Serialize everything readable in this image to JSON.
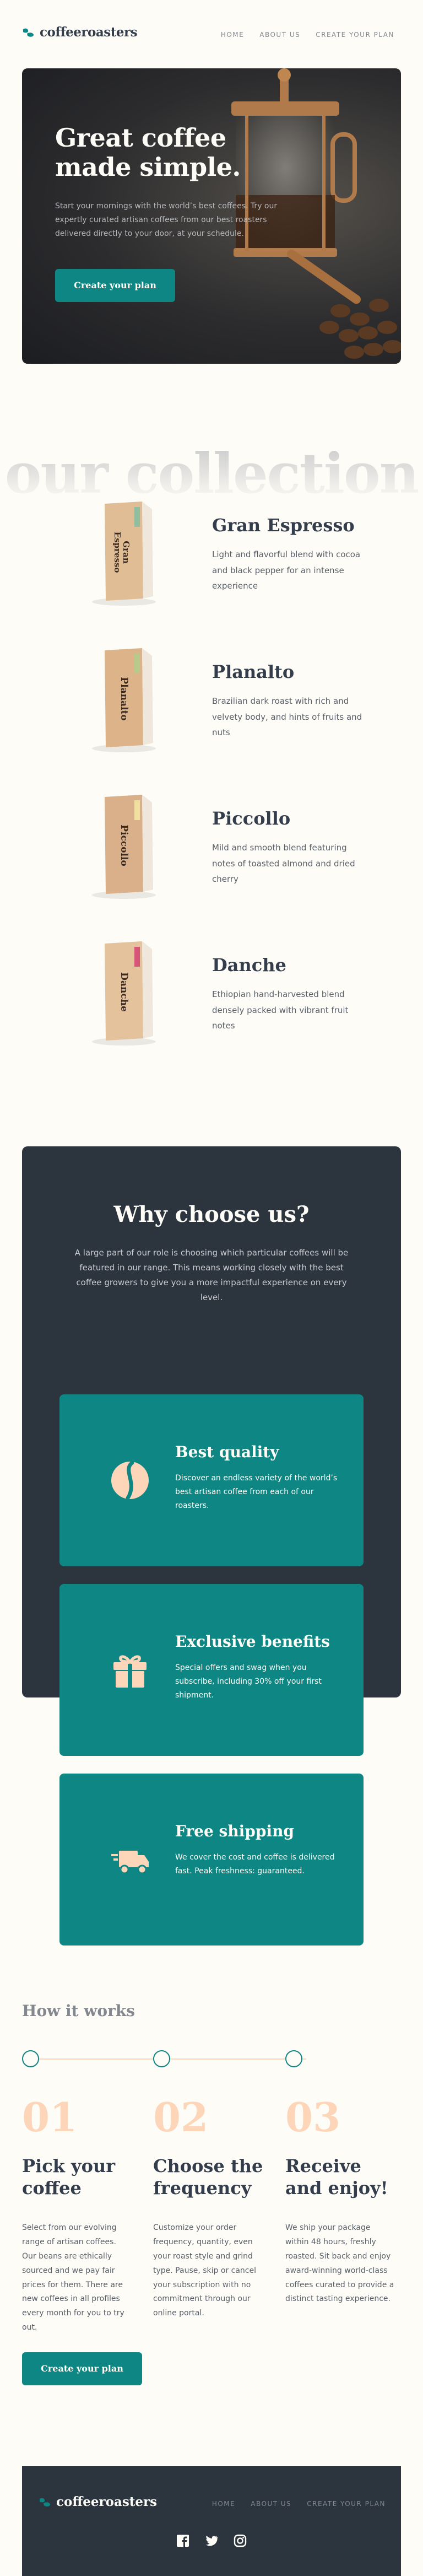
{
  "brand": {
    "name": "coffeeroasters",
    "accent": "#0E8784",
    "dark": "#2C343E",
    "cream": "#FEFCF7",
    "peach": "#FDD6BA"
  },
  "nav": {
    "items": [
      "HOME",
      "ABOUT US",
      "CREATE YOUR PLAN"
    ]
  },
  "hero": {
    "title": "Great coffee made simple.",
    "text": "Start your mornings with the world’s best coffees. Try our expertly curated artisan coffees from our best roasters delivered directly to your door, at your schedule.",
    "cta": "Create your plan"
  },
  "collection": {
    "title": "our collection",
    "items": [
      {
        "name": "Gran Espresso",
        "desc": "Light and flavorful blend with cocoa and black pepper for an intense experience",
        "accent": "#8FBE9E",
        "bag_label": "Gran Espresso"
      },
      {
        "name": "Planalto",
        "desc": "Brazilian dark roast with rich and velvety body, and hints of fruits and nuts",
        "accent": "#B7C98B",
        "bag_label": "Planalto"
      },
      {
        "name": "Piccollo",
        "desc": "Mild and smooth blend featuring notes of toasted almond and dried cherry",
        "accent": "#F0E0A0",
        "bag_label": "Piccollo"
      },
      {
        "name": "Danche",
        "desc": "Ethiopian hand-harvested blend densely packed with vibrant fruit notes",
        "accent": "#D8557A",
        "bag_label": "Danche"
      }
    ]
  },
  "why": {
    "title": "Why choose us?",
    "text": "A large part of our role is choosing which particular coffees will be featured in our range. This means working closely with the best coffee growers to give you a more impactful experience on every level.",
    "features": [
      {
        "icon": "coffee-bean-icon",
        "title": "Best quality",
        "text": "Discover an endless variety of the world’s best artisan coffee from each of our roasters."
      },
      {
        "icon": "gift-icon",
        "title": "Exclusive benefits",
        "text": "Special offers and swag when you subscribe, including 30% off your first shipment."
      },
      {
        "icon": "truck-icon",
        "title": "Free shipping",
        "text": "We cover the cost and coffee is delivered fast. Peak freshness: guaranteed."
      }
    ]
  },
  "how": {
    "title": "How it works",
    "steps": [
      {
        "num": "01",
        "title": "Pick your coffee",
        "text": "Select from our evolving range of artisan coffees. Our beans are ethically sourced and we pay fair prices for them. There are new coffees in all profiles every month for you to try out."
      },
      {
        "num": "02",
        "title": "Choose the frequency",
        "text": "Customize your order frequency, quantity, even your roast style and grind type. Pause, skip or cancel your subscription with no commitment through our online portal."
      },
      {
        "num": "03",
        "title": "Receive and enjoy!",
        "text": "We ship your package within 48 hours, freshly roasted. Sit back and enjoy award-winning world-class coffees curated to provide a distinct tasting experience."
      }
    ],
    "cta": "Create your plan"
  },
  "footer": {
    "brand": "coffeeroasters",
    "nav": [
      "HOME",
      "ABOUT US",
      "CREATE YOUR PLAN"
    ],
    "social": [
      "facebook-icon",
      "twitter-icon",
      "instagram-icon"
    ]
  }
}
